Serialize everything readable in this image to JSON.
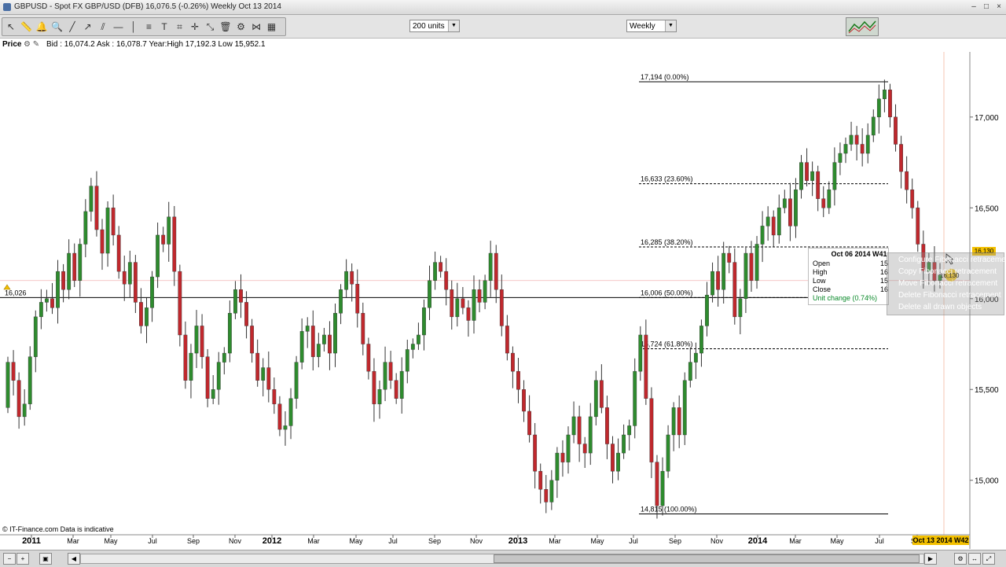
{
  "window": {
    "title": "GBPUSD - Spot FX GBP/USD (DFB)   16,076.5 (-0.26%)   Weekly  Oct 13 2014",
    "controls": [
      "–",
      "□",
      "×"
    ]
  },
  "toolbar": {
    "tool_icons": [
      "pointer-icon",
      "ruler-icon",
      "bell-icon",
      "magnifier-icon",
      "trendline-icon",
      "ray-icon",
      "channel-icon",
      "horizontal-line-icon",
      "vertical-line-icon",
      "fibonacci-icon",
      "text-icon",
      "gann-icon",
      "crosshair-icon",
      "fan-icon",
      "delete-icon",
      "settings-icon",
      "pattern-icon",
      "grid-icon"
    ],
    "units_select": "200 units",
    "interval_select": "Weekly"
  },
  "infobar": {
    "price_label": "Price",
    "stats": "Bid : 16,074.2  Ask : 16,078.7  Year:High 17,192.3  Low 15,952.1"
  },
  "chart_data": {
    "type": "candlestick",
    "title": "",
    "x_ticks": [
      {
        "label": "2011",
        "bold": true
      },
      {
        "label": "Mar"
      },
      {
        "label": "May"
      },
      {
        "label": "Jul"
      },
      {
        "label": "Sep"
      },
      {
        "label": "Nov"
      },
      {
        "label": "2012",
        "bold": true
      },
      {
        "label": "Mar"
      },
      {
        "label": "May"
      },
      {
        "label": "Jul"
      },
      {
        "label": "Sep"
      },
      {
        "label": "Nov"
      },
      {
        "label": "2013",
        "bold": true
      },
      {
        "label": "Mar"
      },
      {
        "label": "May"
      },
      {
        "label": "Jul"
      },
      {
        "label": "Sep"
      },
      {
        "label": "Nov"
      },
      {
        "label": "2014",
        "bold": true
      },
      {
        "label": "Mar"
      },
      {
        "label": "May"
      },
      {
        "label": "Jul"
      },
      {
        "label": "Sep"
      }
    ],
    "y_ticks": [
      "17,000",
      "16,500",
      "16,000",
      "15,500",
      "15,000"
    ],
    "ylim": [
      14700,
      17350
    ],
    "grid": false,
    "fibonacci": [
      {
        "level": 17194,
        "label": "17,194 (0.00%)"
      },
      {
        "level": 16633,
        "label": "16,633 (23.60%)"
      },
      {
        "level": 16285,
        "label": "16,285 (38.20%)"
      },
      {
        "level": 16006,
        "label": "16,006 (50.00%)"
      },
      {
        "level": 15724,
        "label": "15,724 (61.80%)"
      },
      {
        "level": 14815,
        "label": "14,815 (100.00%)"
      }
    ],
    "left_price_label": "16,026",
    "current_price_label": "16,130",
    "right_price_box": "16,130",
    "closes": [
      15650,
      15550,
      15350,
      15420,
      15680,
      15900,
      15980,
      16000,
      15950,
      16150,
      16050,
      16250,
      16100,
      16300,
      16480,
      16620,
      16380,
      16250,
      16500,
      16350,
      16150,
      16080,
      16200,
      15980,
      15850,
      15950,
      16120,
      16350,
      16300,
      16450,
      16150,
      15800,
      15550,
      15700,
      15850,
      15680,
      15450,
      15500,
      15650,
      15700,
      15920,
      16050,
      15980,
      15850,
      15700,
      15550,
      15620,
      15500,
      15420,
      15280,
      15300,
      15450,
      15650,
      15820,
      15850,
      15680,
      15750,
      15800,
      15700,
      15920,
      16050,
      16150,
      16080,
      15920,
      15750,
      15600,
      15420,
      15500,
      15650,
      15550,
      15450,
      15600,
      15720,
      15750,
      15800,
      15950,
      16100,
      16200,
      16150,
      16050,
      15900,
      16000,
      15950,
      15880,
      16050,
      15980,
      16100,
      16250,
      16050,
      15850,
      15700,
      15600,
      15500,
      15380,
      15250,
      15050,
      14950,
      14880,
      15000,
      15150,
      15100,
      15250,
      15350,
      15200,
      15150,
      15350,
      15550,
      15400,
      15200,
      15050,
      15150,
      15250,
      15300,
      15600,
      15800,
      15450,
      15100,
      14860,
      15050,
      15250,
      15400,
      15250,
      15550,
      15650,
      15700,
      15850,
      16020,
      16150,
      16050,
      16250,
      16200,
      15900,
      16000,
      16250,
      16100,
      16300,
      16400,
      16450,
      16350,
      16500,
      16550,
      16400,
      16600,
      16750,
      16650,
      16700,
      16550,
      16500,
      16600,
      16750,
      16800,
      16850,
      16900,
      16850,
      16800,
      16900,
      17000,
      17100,
      17150,
      17000,
      16850,
      16700,
      16600,
      16500,
      16300,
      16150,
      16200,
      16100,
      16130
    ],
    "hover_candle": {
      "date": "Oct 06 2014 W41",
      "change": "Unit change (0.74%)"
    }
  },
  "tooltip": {
    "header": "Oct 06 2014 W41",
    "rows": [
      {
        "label": "Open",
        "value": "15"
      },
      {
        "label": "High",
        "value": "16"
      },
      {
        "label": "Low",
        "value": "15"
      },
      {
        "label": "Close",
        "value": "16"
      }
    ],
    "change": "Unit change (0.74%)"
  },
  "context_menu": {
    "items": [
      "Configure Fibonacci retracement",
      "Copy Fibonacci retracement",
      "Move Fibonacci retracement",
      "Delete Fibonacci retracement",
      "Delete all drawn objects"
    ]
  },
  "footer": {
    "source": "© IT-Finance.com  Data is indicative",
    "current_date": "Oct 13 2014 W42"
  },
  "colors": {
    "up": "#2e8b2e",
    "down": "#c0282d",
    "fib": "#000000",
    "context_text": "#ffffff",
    "highlight": "#f3c000"
  }
}
